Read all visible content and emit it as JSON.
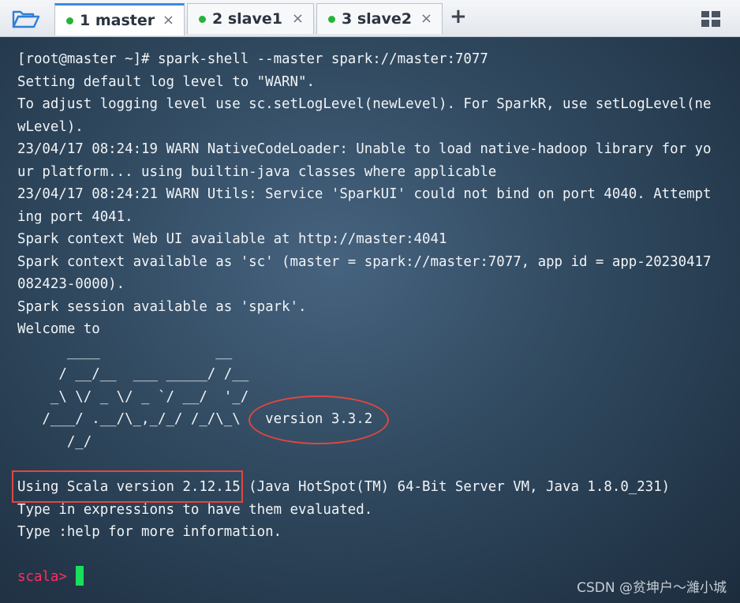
{
  "tabs": [
    {
      "label": "1 master",
      "close": "×",
      "active": true
    },
    {
      "label": "2 slave1",
      "close": "×",
      "active": false
    },
    {
      "label": "3 slave2",
      "close": "×",
      "active": false
    }
  ],
  "toolbar": {
    "add_label": "+",
    "folder_icon": "folder-open-icon",
    "layout_icon": "grid-layout-icon"
  },
  "terminal": {
    "lines": [
      "[root@master ~]# spark-shell --master spark://master:7077",
      "Setting default log level to \"WARN\".",
      "To adjust logging level use sc.setLogLevel(newLevel). For SparkR, use setLogLevel(ne",
      "wLevel).",
      "23/04/17 08:24:19 WARN NativeCodeLoader: Unable to load native-hadoop library for yo",
      "ur platform... using builtin-java classes where applicable",
      "23/04/17 08:24:21 WARN Utils: Service 'SparkUI' could not bind on port 4040. Attempt",
      "ing port 4041.",
      "Spark context Web UI available at http://master:4041",
      "Spark context available as 'sc' (master = spark://master:7077, app id = app-20230417",
      "082423-0000).",
      "Spark session available as 'spark'.",
      "Welcome to"
    ],
    "logo": [
      "      ____              __",
      "     / __/__  ___ _____/ /__",
      "    _\\ \\/ _ \\/ _ `/ __/  '_/",
      "   /___/ .__/\\_,_/_/ /_/\\_\\   version 3.3.2",
      "      /_/"
    ],
    "after": [
      "Using Scala version 2.12.15 (Java HotSpot(TM) 64-Bit Server VM, Java 1.8.0_231)",
      "Type in expressions to have them evaluated.",
      "Type :help for more information."
    ],
    "prompt": "scala>"
  },
  "watermark": "CSDN @贫坤户～濰小城",
  "colors": {
    "accent": "#3d8be0",
    "active_dot": "#26b33a",
    "prompt": "#ff2e5e",
    "cursor": "#19e05c",
    "annotation": "#e0473f"
  }
}
